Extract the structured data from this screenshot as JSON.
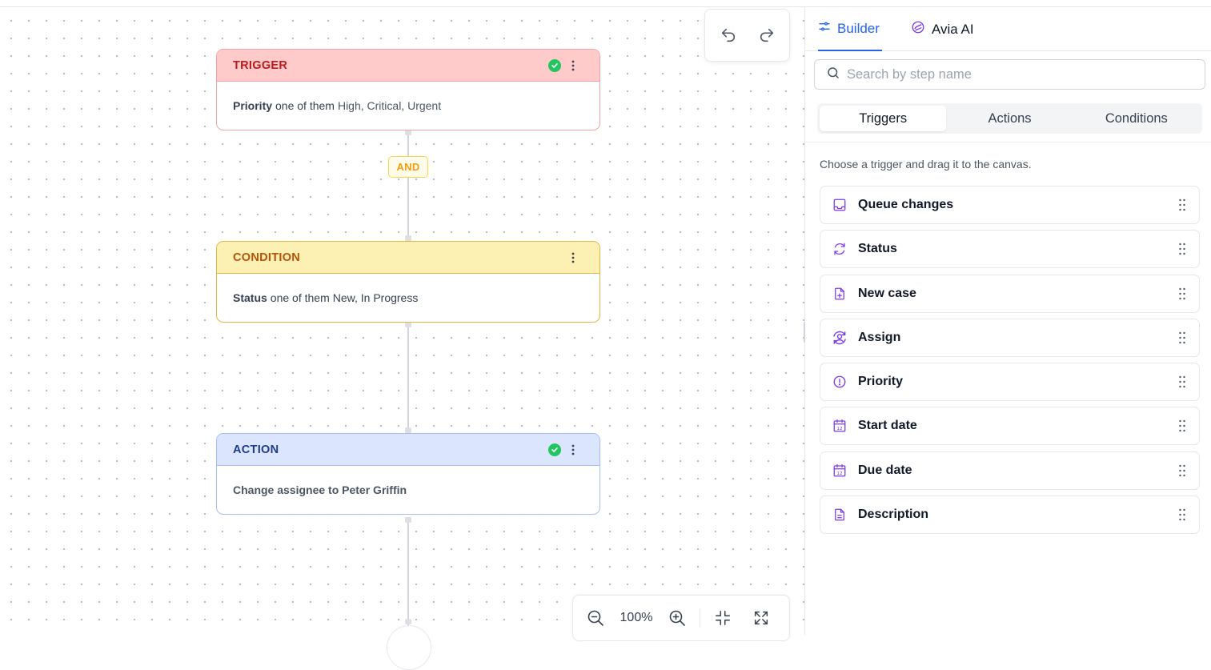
{
  "canvas": {
    "nodes": {
      "trigger": {
        "type_label": "TRIGGER",
        "field": "Priority",
        "operator": "one of them",
        "value": "High, Critical, Urgent"
      },
      "and_label": "AND",
      "condition": {
        "type_label": "CONDITION",
        "field": "Status",
        "operator": "one of them",
        "value": "New, In Progress"
      },
      "action": {
        "type_label": "ACTION",
        "text": "Change assignee to Peter Griffin"
      }
    },
    "zoom": {
      "value": "100%"
    }
  },
  "panel": {
    "tabs": [
      {
        "label": "Builder",
        "icon": "sliders-icon",
        "active": true
      },
      {
        "label": "Avia AI",
        "icon": "avia-ai-icon",
        "active": false
      }
    ],
    "search": {
      "placeholder": "Search by step name",
      "value": ""
    },
    "segments": [
      {
        "label": "Triggers",
        "active": true
      },
      {
        "label": "Actions",
        "active": false
      },
      {
        "label": "Conditions",
        "active": false
      }
    ],
    "hint": "Choose a trigger and drag it to the canvas.",
    "items": [
      {
        "label": "Queue changes",
        "icon": "inbox-icon"
      },
      {
        "label": "Status",
        "icon": "refresh-icon"
      },
      {
        "label": "New case",
        "icon": "file-plus-icon"
      },
      {
        "label": "Assign",
        "icon": "user-cycle-icon"
      },
      {
        "label": "Priority",
        "icon": "alert-circle-icon"
      },
      {
        "label": "Start date",
        "icon": "calendar-icon"
      },
      {
        "label": "Due date",
        "icon": "calendar-icon"
      },
      {
        "label": "Description",
        "icon": "file-text-icon"
      }
    ]
  },
  "colors": {
    "accent": "#2563eb",
    "trigger_bg": "#fecaca",
    "condition_bg": "#fdf0b3",
    "action_bg": "#dbe6fe",
    "icon_purple": "#7c3aed",
    "success": "#22c55e"
  }
}
